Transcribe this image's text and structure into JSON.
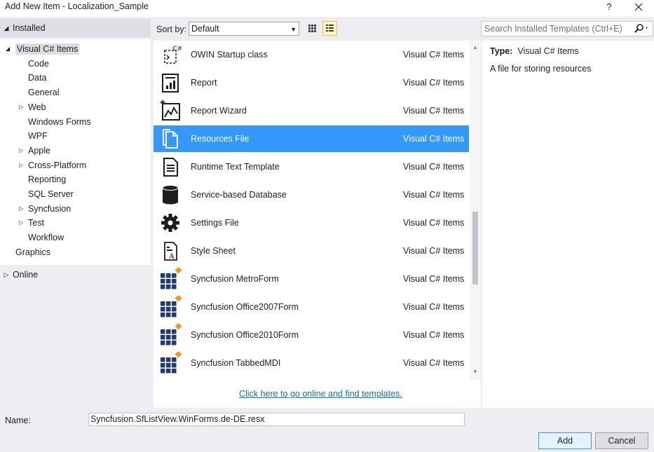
{
  "window": {
    "title": "Add New Item - Localization_Sample",
    "help_label": "?"
  },
  "left": {
    "installed_label": "Installed",
    "online_label": "Online",
    "tree": [
      {
        "label": "Visual C# Items",
        "level": 0,
        "expandable": true,
        "expanded": true,
        "selected": true
      },
      {
        "label": "Code",
        "level": 1,
        "expandable": false
      },
      {
        "label": "Data",
        "level": 1,
        "expandable": false
      },
      {
        "label": "General",
        "level": 1,
        "expandable": false
      },
      {
        "label": "Web",
        "level": 1,
        "expandable": true
      },
      {
        "label": "Windows Forms",
        "level": 1,
        "expandable": false
      },
      {
        "label": "WPF",
        "level": 1,
        "expandable": false
      },
      {
        "label": "Apple",
        "level": 1,
        "expandable": true
      },
      {
        "label": "Cross-Platform",
        "level": 1,
        "expandable": true
      },
      {
        "label": "Reporting",
        "level": 1,
        "expandable": false
      },
      {
        "label": "SQL Server",
        "level": 1,
        "expandable": false
      },
      {
        "label": "Syncfusion",
        "level": 1,
        "expandable": true
      },
      {
        "label": "Test",
        "level": 1,
        "expandable": true
      },
      {
        "label": "Workflow",
        "level": 1,
        "expandable": false
      },
      {
        "label": "Graphics",
        "level": 0,
        "expandable": false
      }
    ]
  },
  "toolbar": {
    "sort_label": "Sort by:",
    "sort_value": "Default",
    "search_placeholder": "Search Installed Templates (Ctrl+E)"
  },
  "templates": [
    {
      "name": "OWIN Startup class",
      "category": "Visual C# Items",
      "icon": "owin-icon"
    },
    {
      "name": "Report",
      "category": "Visual C# Items",
      "icon": "report-icon"
    },
    {
      "name": "Report Wizard",
      "category": "Visual C# Items",
      "icon": "report-wizard-icon"
    },
    {
      "name": "Resources File",
      "category": "Visual C# Items",
      "icon": "resources-file-icon",
      "selected": true
    },
    {
      "name": "Runtime Text Template",
      "category": "Visual C# Items",
      "icon": "text-template-icon"
    },
    {
      "name": "Service-based Database",
      "category": "Visual C# Items",
      "icon": "database-icon"
    },
    {
      "name": "Settings File",
      "category": "Visual C# Items",
      "icon": "settings-gear-icon"
    },
    {
      "name": "Style Sheet",
      "category": "Visual C# Items",
      "icon": "style-sheet-icon"
    },
    {
      "name": "Syncfusion MetroForm",
      "category": "Visual C# Items",
      "icon": "syncfusion-icon"
    },
    {
      "name": "Syncfusion Office2007Form",
      "category": "Visual C# Items",
      "icon": "syncfusion-icon"
    },
    {
      "name": "Syncfusion Office2010Form",
      "category": "Visual C# Items",
      "icon": "syncfusion-icon"
    },
    {
      "name": "Syncfusion TabbedMDI",
      "category": "Visual C# Items",
      "icon": "syncfusion-icon"
    }
  ],
  "online_link": "Click here to go online and find templates.",
  "details": {
    "type_label": "Type:",
    "type_value": "Visual C# Items",
    "description": "A file for storing resources"
  },
  "footer": {
    "name_label": "Name:",
    "name_value": "Syncfusion.SfListView.WinForms.de-DE.resx",
    "add_label": "Add",
    "cancel_label": "Cancel"
  },
  "colors": {
    "selection": "#3399ff",
    "link": "#0e70c0",
    "syncfusion_blue": "#1f3a7a",
    "syncfusion_orange": "#f7941d"
  }
}
